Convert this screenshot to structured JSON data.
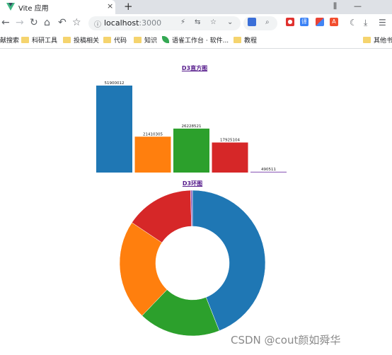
{
  "browser": {
    "tab_title": "Vite 应用",
    "tab_close": "×",
    "new_tab": "+",
    "url_host": "localhost",
    "url_port": ":3000",
    "nav": {
      "back": "←",
      "forward": "→",
      "reload": "↻",
      "home": "⌂",
      "undo": "↶",
      "bookmark_star": "☆"
    },
    "omnibox_icons": [
      "lightning-icon",
      "translate-icon",
      "star-icon",
      "chevron-down-icon"
    ],
    "extensions": [
      "weibo-icon",
      "translate-ext-icon",
      "grid-ext-icon",
      "pdf-ext-icon",
      "moon-icon",
      "download-icon",
      "menu-icon"
    ],
    "window_controls": [
      "pin-icon",
      "minimize-icon"
    ]
  },
  "bookmarks": [
    {
      "label": "献搜索",
      "icon": "none"
    },
    {
      "label": "科研工具",
      "icon": "folder"
    },
    {
      "label": "投稿相关",
      "icon": "folder"
    },
    {
      "label": "代码",
      "icon": "folder"
    },
    {
      "label": "知识",
      "icon": "folder"
    },
    {
      "label": "语雀工作台 · 软件...",
      "icon": "leaf"
    },
    {
      "label": "教程",
      "icon": "folder"
    },
    {
      "label": "其他书",
      "icon": "folder"
    }
  ],
  "page": {
    "bar_title": "D3直方图",
    "donut_title": "D3环图"
  },
  "chart_data": [
    {
      "type": "bar",
      "title": "D3直方图",
      "values": [
        51900012,
        21410305,
        26228521,
        17925104,
        490511
      ],
      "data_labels": [
        "51900012",
        "21410305",
        "26228521",
        "17925104",
        "490511"
      ],
      "colors": [
        "#1f77b4",
        "#ff7f0e",
        "#2ca02c",
        "#d62728",
        "#9467bd"
      ]
    },
    {
      "type": "pie",
      "title": "D3环图",
      "values": [
        51900012,
        21410305,
        26228521,
        17925104,
        490511
      ],
      "colors": [
        "#1f77b4",
        "#2ca02c",
        "#ff7f0e",
        "#d62728",
        "#9467bd"
      ],
      "donut": true
    }
  ],
  "watermark": "CSDN @cout颜如舜华"
}
